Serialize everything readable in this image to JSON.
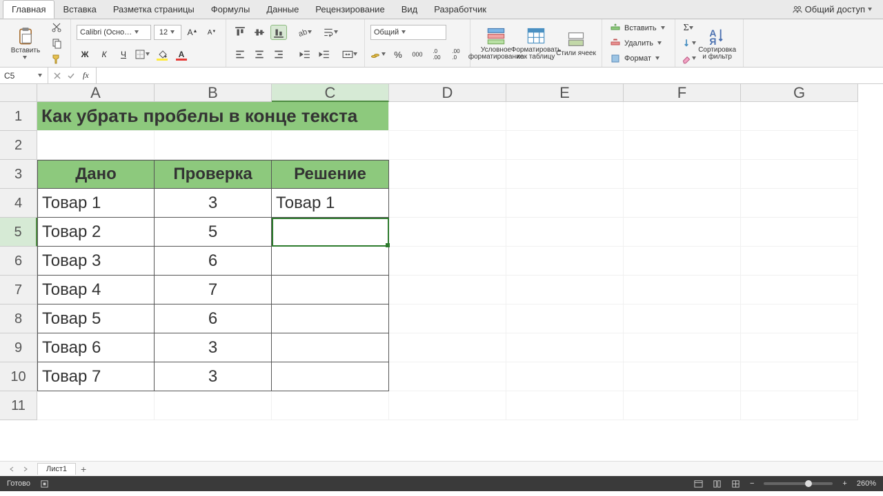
{
  "tabs": [
    "Главная",
    "Вставка",
    "Разметка страницы",
    "Формулы",
    "Данные",
    "Рецензирование",
    "Вид",
    "Разработчик"
  ],
  "active_tab": 0,
  "share_label": "Общий доступ",
  "ribbon": {
    "paste": "Вставить",
    "font_name": "Calibri (Осно…",
    "font_size": "12",
    "number_format": "Общий",
    "cond_format": "Условное форматирование",
    "as_table": "Форматировать как таблицу",
    "cell_styles": "Стили ячеек",
    "insert": "Вставить",
    "delete": "Удалить",
    "format": "Формат",
    "sort_filter": "Сортировка и фильтр"
  },
  "namebox": "C5",
  "formula": "",
  "columns": [
    "A",
    "B",
    "C",
    "D",
    "E",
    "F",
    "G"
  ],
  "row_h": [
    1,
    2,
    3,
    4,
    5,
    6,
    7,
    8,
    9,
    10,
    11
  ],
  "title": "Как убрать пробелы в конце текста",
  "headers": [
    "Дано",
    "Проверка",
    "Решение"
  ],
  "rows": [
    {
      "a": "Товар 1",
      "b": "3",
      "c": "Товар 1"
    },
    {
      "a": "Товар 2",
      "b": "5",
      "c": ""
    },
    {
      "a": "Товар 3",
      "b": "6",
      "c": ""
    },
    {
      "a": "Товар 4",
      "b": "7",
      "c": ""
    },
    {
      "a": "Товар 5",
      "b": "6",
      "c": ""
    },
    {
      "a": "Товар 6",
      "b": "3",
      "c": ""
    },
    {
      "a": "Товар 7",
      "b": "3",
      "c": ""
    }
  ],
  "active": {
    "col": "C",
    "row": 5
  },
  "sheet_tab": "Лист1",
  "status": "Готово",
  "zoom": "260%",
  "colors": {
    "accent": "#8dc97d",
    "grid_border": "#555"
  }
}
